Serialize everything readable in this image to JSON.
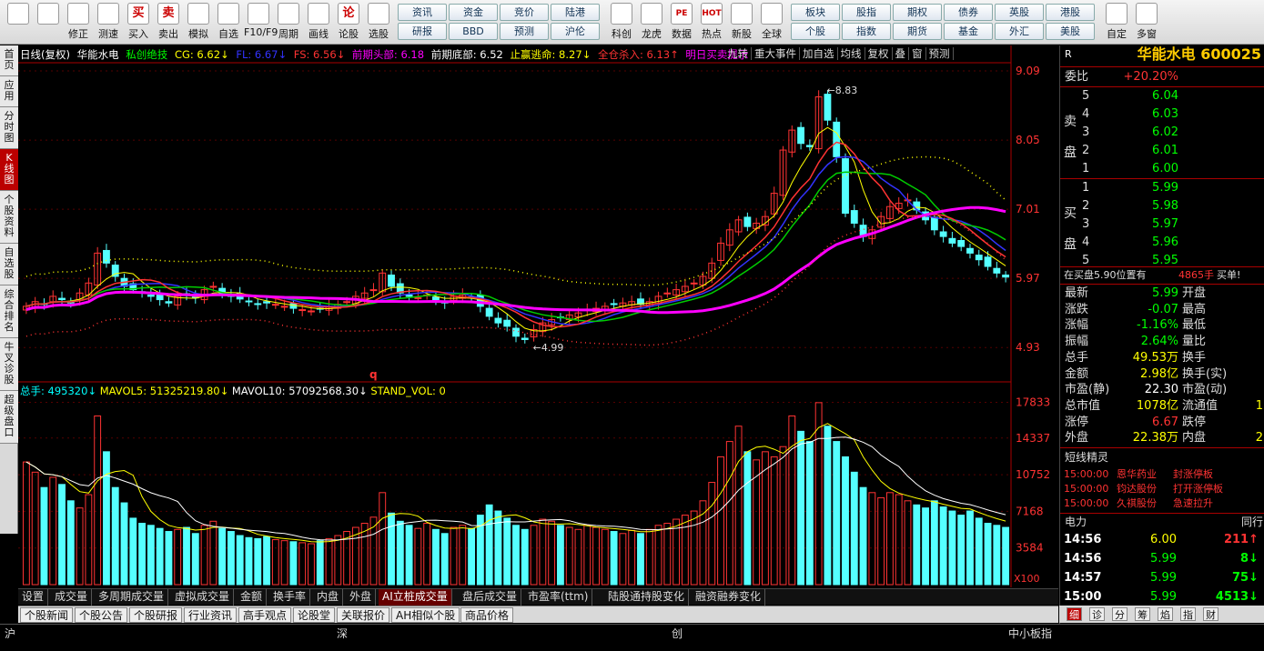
{
  "toolbar": {
    "buttons": [
      {
        "label": "",
        "icon": "grid-icon"
      },
      {
        "label": "",
        "icon": "back-arrow-icon"
      },
      {
        "label": "修正",
        "icon": "up-arrow-icon"
      },
      {
        "label": "测速",
        "icon": "clock-icon"
      },
      {
        "label": "买入",
        "icon": "buy-icon",
        "glyph": "买"
      },
      {
        "label": "卖出",
        "icon": "sell-icon",
        "glyph": "卖"
      },
      {
        "label": "模拟",
        "icon": "hammer-icon"
      },
      {
        "label": "自选",
        "icon": "star-icon"
      },
      {
        "label": "F10/F9",
        "icon": "f10-icon"
      },
      {
        "label": "周期",
        "icon": "cycle-icon"
      },
      {
        "label": "画线",
        "icon": "pencil-icon"
      },
      {
        "label": "论股",
        "icon": "discuss-icon",
        "glyph": "论"
      },
      {
        "label": "选股",
        "icon": "select-stock-icon"
      }
    ],
    "grid": [
      [
        "资讯",
        "资金",
        "竞价",
        "陆港"
      ],
      [
        "研报",
        "BBD",
        "预测",
        "沪伦"
      ]
    ],
    "buttons2": [
      {
        "label": "科创",
        "icon": "star-market-icon"
      },
      {
        "label": "龙虎",
        "icon": "dragon-tiger-icon"
      },
      {
        "label": "数据",
        "icon": "pe-icon",
        "glyph": "PE"
      },
      {
        "label": "热点",
        "icon": "hot-icon",
        "glyph": "HOT"
      },
      {
        "label": "新股",
        "icon": "ipo-icon"
      },
      {
        "label": "全球",
        "icon": "globe-icon"
      }
    ],
    "grid2": [
      [
        "板块",
        "股指",
        "期权",
        "债券",
        "英股",
        "港股"
      ],
      [
        "个股",
        "指数",
        "期货",
        "基金",
        "外汇",
        "美股"
      ]
    ],
    "buttons3": [
      {
        "label": "自定",
        "icon": "custom-icon"
      },
      {
        "label": "多窗",
        "icon": "multi-window-icon"
      }
    ]
  },
  "left_tabs": [
    {
      "label": "首页",
      "active": false
    },
    {
      "label": "应用",
      "active": false
    },
    {
      "label": "分时图",
      "active": false
    },
    {
      "label": "K线图",
      "active": true
    },
    {
      "label": "个股资料",
      "active": false
    },
    {
      "label": "自选股",
      "active": false
    },
    {
      "label": "综合排名",
      "active": false
    },
    {
      "label": "牛叉诊股",
      "active": false
    },
    {
      "label": "超级盘口",
      "active": false
    }
  ],
  "chart_header": {
    "period": "日线(复权)",
    "name": "华能水电",
    "indicator": "私创绝技",
    "cg": "CG: 6.62↓",
    "fl": "FL: 6.67↓",
    "fs": "FS: 6.56↓",
    "prev_top": "前期头部: 6.18",
    "prev_bottom": "前期底部: 6.52",
    "take_profit": "止赢逃命: 8.27↓",
    "kill": "全仓杀入: 6.13↑",
    "tomorrow": "明日买卖提示"
  },
  "chart_tools": [
    "九转",
    "重大事件",
    "加自选",
    "均线",
    "复权",
    "叠",
    "窗",
    "预测"
  ],
  "chart_data": [
    {
      "type": "candlestick",
      "title": "日线(复权)",
      "y_ticks": [
        9.09,
        8.05,
        7.01,
        5.97,
        4.93
      ],
      "ylim": [
        4.55,
        9.2
      ],
      "annotations": [
        {
          "text": "8.83"
        },
        {
          "text": "4.99"
        },
        {
          "text": "q"
        }
      ],
      "close": [
        5.55,
        5.62,
        5.58,
        5.7,
        5.65,
        5.6,
        5.75,
        5.9,
        6.35,
        6.2,
        6.0,
        5.85,
        5.8,
        5.75,
        5.7,
        5.65,
        5.6,
        5.7,
        5.72,
        5.68,
        5.8,
        5.85,
        5.75,
        5.7,
        5.66,
        5.62,
        5.58,
        5.6,
        5.58,
        5.55,
        5.52,
        5.5,
        5.48,
        5.52,
        5.55,
        5.58,
        5.62,
        5.7,
        5.75,
        5.8,
        6.05,
        5.85,
        5.75,
        5.7,
        5.68,
        5.72,
        5.65,
        5.6,
        5.7,
        5.72,
        5.68,
        5.55,
        5.4,
        5.3,
        5.25,
        5.1,
        5.05,
        5.2,
        5.3,
        5.35,
        5.38,
        5.42,
        5.45,
        5.5,
        5.52,
        5.55,
        5.58,
        5.6,
        5.62,
        5.58,
        5.62,
        5.7,
        5.75,
        5.8,
        5.85,
        5.9,
        6.0,
        6.2,
        6.5,
        6.7,
        6.85,
        6.75,
        6.8,
        6.9,
        7.25,
        7.9,
        8.2,
        8.0,
        7.95,
        8.7,
        8.35,
        7.8,
        6.95,
        6.8,
        6.6,
        6.7,
        6.9,
        7.05,
        7.1,
        7.15,
        7.0,
        6.85,
        6.7,
        6.6,
        6.5,
        6.45,
        6.35,
        6.25,
        6.15,
        6.05,
        5.99
      ],
      "volume": [
        12000,
        11000,
        9500,
        10500,
        9800,
        8200,
        7500,
        8800,
        16500,
        13000,
        9500,
        8000,
        6500,
        6000,
        5800,
        5500,
        5200,
        5400,
        5600,
        5000,
        5800,
        6200,
        5500,
        5200,
        4800,
        4600,
        4500,
        4700,
        4400,
        4300,
        4200,
        4100,
        4000,
        4300,
        4500,
        4800,
        5200,
        5600,
        6000,
        6600,
        9000,
        7000,
        6200,
        5800,
        5500,
        6000,
        5400,
        5000,
        5600,
        5800,
        5500,
        6800,
        7800,
        7200,
        6500,
        5800,
        5400,
        5800,
        6400,
        6200,
        5800,
        5600,
        5400,
        5800,
        5600,
        5400,
        5200,
        5000,
        5300,
        5000,
        5400,
        5800,
        6000,
        6400,
        6800,
        7200,
        8200,
        10000,
        12500,
        14000,
        15500,
        13000,
        12200,
        13000,
        12500,
        13500,
        16500,
        15000,
        14000,
        17800,
        15500,
        14000,
        12500,
        11000,
        9500,
        9000,
        8500,
        9000,
        8800,
        8200,
        7800,
        7500,
        8200,
        7600,
        7200,
        6800,
        7200,
        6500,
        6000,
        5800,
        5600
      ],
      "vol_ticks": [
        17833,
        14337,
        10752,
        7168,
        3584
      ],
      "vol_unit": "X100"
    }
  ],
  "vol_header": {
    "total": "总手: 495320↓",
    "mavol5": "MAVOL5: 51325219.80↓",
    "mavol10": "MAVOL10: 57092568.30↓",
    "stand": "STAND_VOL: 0"
  },
  "sub_tabs": [
    "设置",
    "成交量",
    "多周期成交量",
    "虚拟成交量",
    "金额",
    "换手率",
    "内盘",
    "外盘",
    "AI立桩成交量",
    "盘后成交量",
    "市盈率(ttm)",
    "陆股通持股变化",
    "融资融券变化"
  ],
  "sub_tab_active": 8,
  "news_tabs": [
    "个股新闻",
    "个股公告",
    "个股研报",
    "行业资讯",
    "高手观点",
    "论股堂",
    "关联报价",
    "AH相似个股",
    "商品价格"
  ],
  "status": {
    "sh": "沪",
    "sz": "深",
    "cy": "创",
    "zxb": "中小板指"
  },
  "right": {
    "badge": "R",
    "name": "华能水电",
    "code": "600025",
    "weibi_label": "委比",
    "weibi": "+20.20%",
    "sell_label": "卖盘",
    "buy_label": "买盘",
    "sell": [
      [
        "5",
        "6.04"
      ],
      [
        "4",
        "6.03"
      ],
      [
        "3",
        "6.02"
      ],
      [
        "2",
        "6.01"
      ],
      [
        "1",
        "6.00"
      ]
    ],
    "buy": [
      [
        "1",
        "5.99"
      ],
      [
        "2",
        "5.98"
      ],
      [
        "3",
        "5.97"
      ],
      [
        "4",
        "5.96"
      ],
      [
        "5",
        "5.95"
      ]
    ],
    "bid_note": "在买盘5.90位置有",
    "bid_qty": "4865手",
    "bid_tail": "买单!",
    "stats": [
      [
        "最新",
        "5.99",
        "开盘",
        ""
      ],
      [
        "涨跌",
        "-0.07",
        "最高",
        ""
      ],
      [
        "涨幅",
        "-1.16%",
        "最低",
        ""
      ],
      [
        "振幅",
        "2.64%",
        "量比",
        ""
      ],
      [
        "总手",
        "49.53万",
        "换手",
        ""
      ],
      [
        "金额",
        "2.98亿",
        "换手(实)",
        ""
      ],
      [
        "市盈(静)",
        "22.30",
        "市盈(动)",
        ""
      ],
      [
        "总市值",
        "1078亿",
        "流通值",
        "1"
      ],
      [
        "涨停",
        "6.67",
        "跌停",
        ""
      ],
      [
        "外盘",
        "22.38万",
        "内盘",
        "2"
      ]
    ],
    "short_title": "短线精灵",
    "short_items": [
      [
        "15:00:00",
        "恩华药业",
        "封涨停板"
      ],
      [
        "15:00:00",
        "钧达股份",
        "打开涨停板"
      ],
      [
        "15:00:00",
        "久祺股份",
        "急速拉升"
      ]
    ],
    "trade_header": [
      "电力",
      "同行"
    ],
    "trades": [
      [
        "14:56",
        "6.00",
        "211",
        "up"
      ],
      [
        "14:56",
        "5.99",
        "8",
        "down"
      ],
      [
        "14:57",
        "5.99",
        "75",
        "down"
      ],
      [
        "15:00",
        "5.99",
        "4513",
        "down"
      ]
    ],
    "bottom_tabs": [
      "细",
      "诊",
      "分",
      "筹",
      "焰",
      "指",
      "财"
    ]
  }
}
